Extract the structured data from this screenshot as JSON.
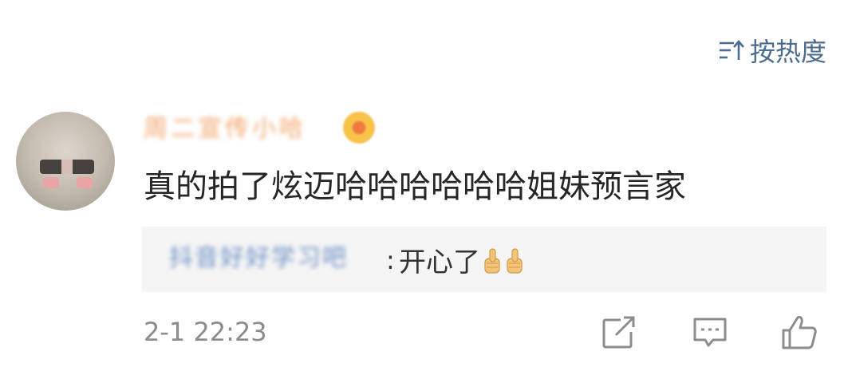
{
  "sort_toggle": {
    "label": "按热度",
    "icon": "sort-arrow-icon"
  },
  "comment": {
    "username": "周二宣传小哈",
    "badge_icon": "vip-badge-icon",
    "text": "真的拍了炫迈哈哈哈哈哈哈姐妹预言家",
    "timestamp": "2-1 22:23"
  },
  "reply": {
    "author": "抖音好好学习吧",
    "separator": ":",
    "text": "开心了"
  },
  "actions": {
    "share_icon": "share-icon",
    "reply_icon": "comment-icon",
    "like_icon": "thumbs-up-icon"
  },
  "colors": {
    "accent_blue": "#4b6b8f",
    "username_orange": "#f3a368",
    "reply_author_blue": "#6d8fc6",
    "text_dark": "#262626",
    "meta_gray": "#8c8c8c",
    "reply_bg": "#f5f5f5"
  }
}
